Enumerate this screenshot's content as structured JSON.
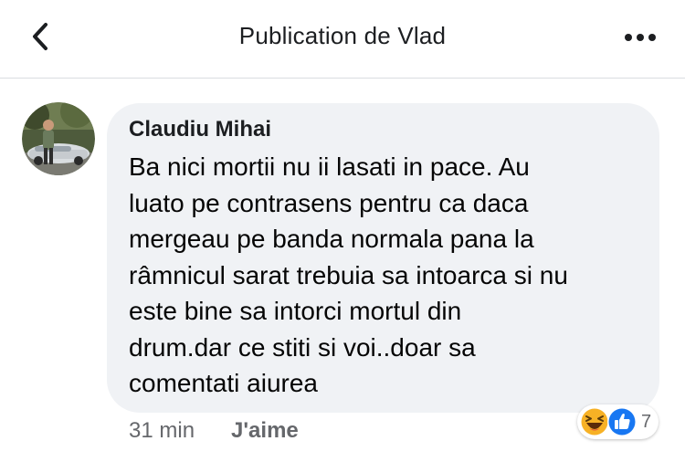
{
  "header": {
    "title": "Publication de Vlad",
    "back_icon": "chevron-left-icon",
    "more_icon": "more-horizontal-icon"
  },
  "comment": {
    "author": "Claudiu Mihai",
    "text": "Ba nici mortii nu ii lasati in pace. Au\nluato pe contrasens pentru ca daca\nmergeau pe banda normala pana la\nrâmnicul sarat trebuia sa intoarca si nu\neste bine sa intorci mortul din\ndrum.dar ce stiti si voi..doar sa\ncomentati aiurea",
    "time": "31 min",
    "like_label": "J'aime",
    "reactions": {
      "icons": [
        "haha-reaction-icon",
        "like-reaction-icon"
      ],
      "count": "7"
    }
  },
  "colors": {
    "bubble": "#f0f2f5",
    "meta_text": "#65676b",
    "like_blue": "#1877f2",
    "haha_yellow": "#f7b125"
  }
}
